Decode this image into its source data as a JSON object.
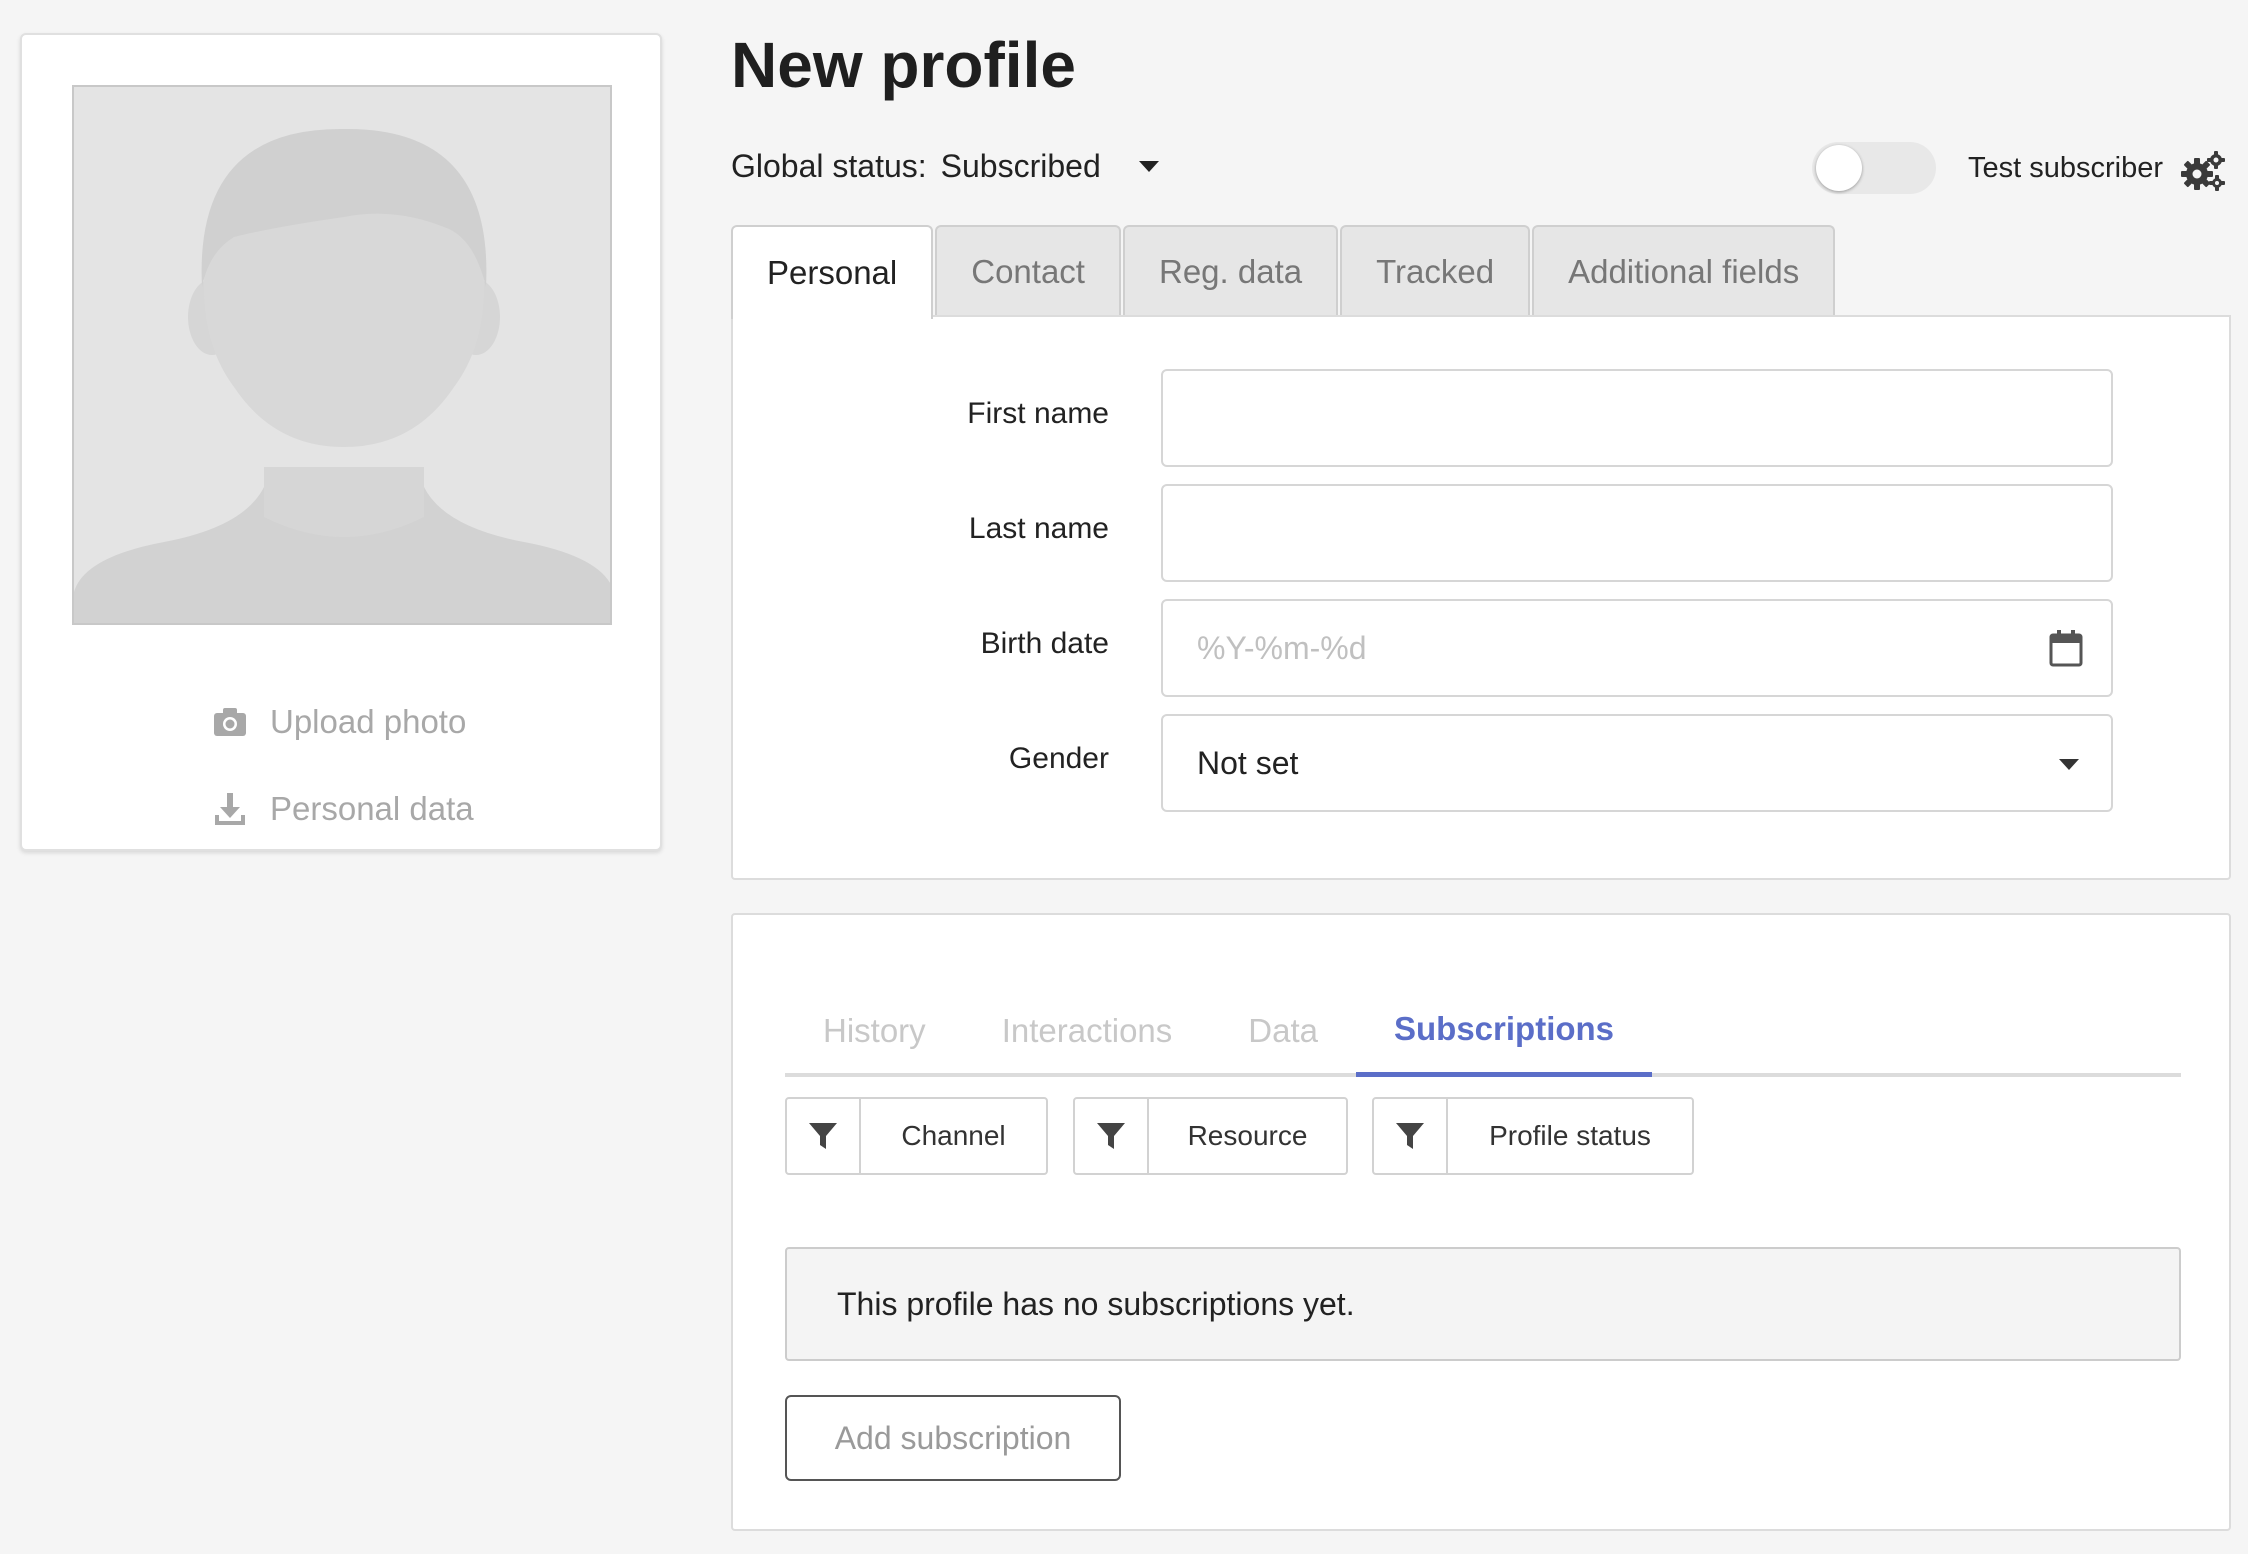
{
  "page": {
    "title": "New profile"
  },
  "colors": {
    "accent": "#5b6ec8",
    "muted_text": "#a8a8a8",
    "background": "#f5f5f5"
  },
  "photo_card": {
    "upload_photo": "Upload photo",
    "personal_data": "Personal data",
    "icons": {
      "upload": "camera-icon",
      "personal_data": "download-icon"
    }
  },
  "status": {
    "label": "Global status:",
    "value": "Subscribed",
    "test_subscriber_label": "Test subscriber",
    "test_subscriber_enabled": false
  },
  "tabs": [
    {
      "label": "Personal",
      "active": true
    },
    {
      "label": "Contact"
    },
    {
      "label": "Reg. data"
    },
    {
      "label": "Tracked"
    },
    {
      "label": "Additional fields"
    }
  ],
  "form": {
    "first_name": {
      "label": "First name",
      "value": ""
    },
    "last_name": {
      "label": "Last name",
      "value": ""
    },
    "birth_date": {
      "label": "Birth date",
      "placeholder": "%Y-%m-%d"
    },
    "gender": {
      "label": "Gender",
      "value": "Not set"
    }
  },
  "subtabs": [
    {
      "label": "History"
    },
    {
      "label": "Interactions"
    },
    {
      "label": "Data"
    },
    {
      "label": "Subscriptions",
      "active": true
    }
  ],
  "filters": [
    {
      "label": "Channel"
    },
    {
      "label": "Resource"
    },
    {
      "label": "Profile status"
    }
  ],
  "subscriptions": {
    "empty_message": "This profile has no subscriptions yet.",
    "add_button": "Add subscription"
  }
}
